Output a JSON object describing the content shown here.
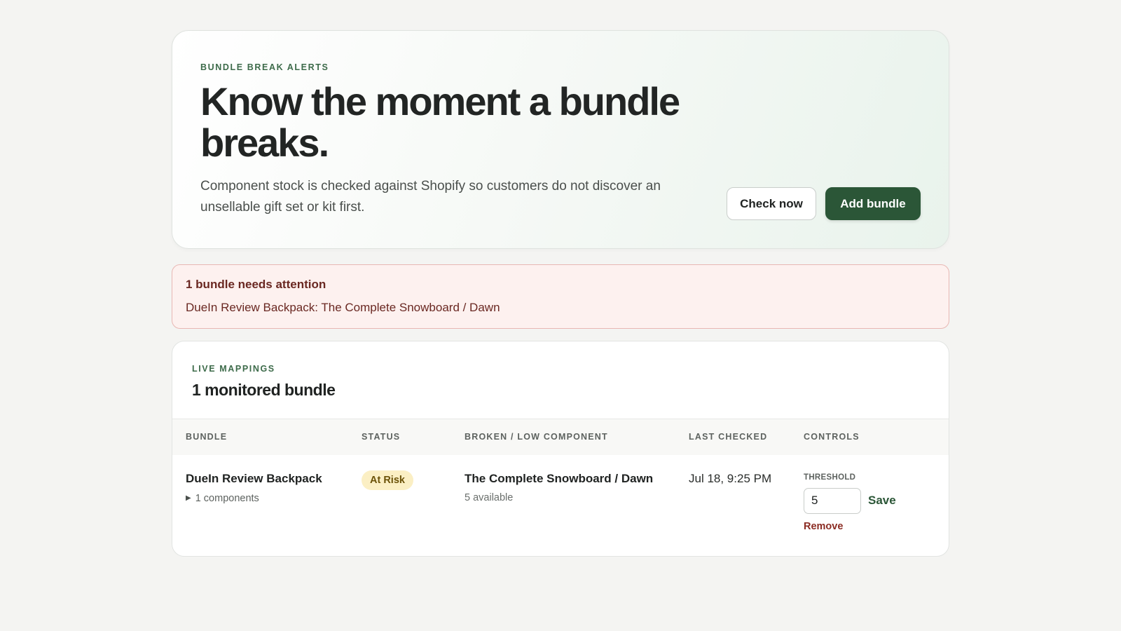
{
  "hero": {
    "eyebrow": "BUNDLE BREAK ALERTS",
    "title": "Know the moment a bundle breaks.",
    "subtitle": "Component stock is checked against Shopify so customers do not discover an unsellable gift set or kit first.",
    "check_now_label": "Check now",
    "add_bundle_label": "Add bundle"
  },
  "alert": {
    "title": "1 bundle needs attention",
    "items": [
      "DueIn Review Backpack: The Complete Snowboard / Dawn"
    ]
  },
  "mappings": {
    "eyebrow": "LIVE MAPPINGS",
    "title": "1 monitored bundle",
    "columns": [
      "BUNDLE",
      "STATUS",
      "BROKEN / LOW COMPONENT",
      "LAST CHECKED",
      "CONTROLS"
    ],
    "rows": [
      {
        "bundle": "DueIn Review Backpack",
        "components": "1 components",
        "status": "At Risk",
        "component_name": "The Complete Snowboard / Dawn",
        "component_available": "5 available",
        "last_checked": "Jul 18, 9:25 PM",
        "threshold_label": "THRESHOLD",
        "threshold_value": "5",
        "save_label": "Save",
        "remove_label": "Remove"
      }
    ]
  },
  "colors": {
    "accent": "#2b5637",
    "alert_bg": "#fdf1ef",
    "alert_text": "#6a2822",
    "badge_bg": "#fbefc4",
    "badge_text": "#6b5208",
    "remove": "#8b2c23"
  }
}
